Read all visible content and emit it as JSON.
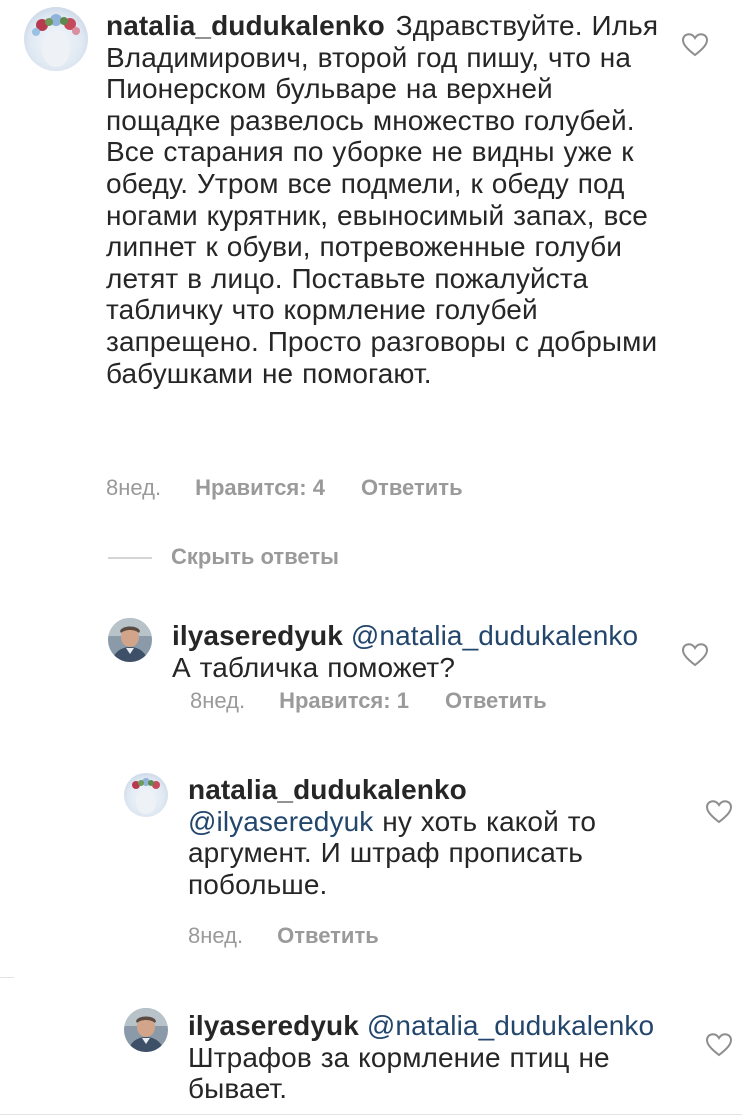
{
  "comments": [
    {
      "username": "natalia_dudukalenko",
      "text": "Здравствуйте. Илья Владимирович, второй год пишу, что на Пионерском бульваре на верхней пощадке развелось множество голубей.  Все старания по уборке не видны уже к обеду.  Утром все подмели, к обеду под ногами курятник, евыносимый запах, все липнет к обуви, потревоженные голуби летят в лицо. Поставьте пожалуйста табличку что кормление голубей запрещено. Просто разговоры с добрыми бабушками не помогают.",
      "time": "8нед.",
      "likes": "Нравится: 4",
      "reply": "Ответить"
    }
  ],
  "hide_replies": "Скрыть ответы",
  "replies": [
    {
      "username": "ilyaseredyuk",
      "mention": "@natalia_dudukalenko",
      "text": "А табличка поможет?",
      "time": "8нед.",
      "likes": "Нравится: 1",
      "reply": "Ответить"
    },
    {
      "username": "natalia_dudukalenko",
      "mention": "@ilyaseredyuk",
      "text": "ну хоть какой то аргумент. И штраф прописать побольше.",
      "time": "8нед.",
      "reply": "Ответить"
    },
    {
      "username": "ilyaseredyuk",
      "mention": "@natalia_dudukalenko",
      "text": "Штрафов за кормление птиц не бывает."
    }
  ],
  "icons": {
    "like": "heart-outline-icon",
    "avatar_natalia": "avatar-flower-wreath",
    "avatar_ilya": "avatar-man-photo"
  },
  "colors": {
    "text": "#262626",
    "meta": "#9a9a9a",
    "mention": "#23466d"
  }
}
